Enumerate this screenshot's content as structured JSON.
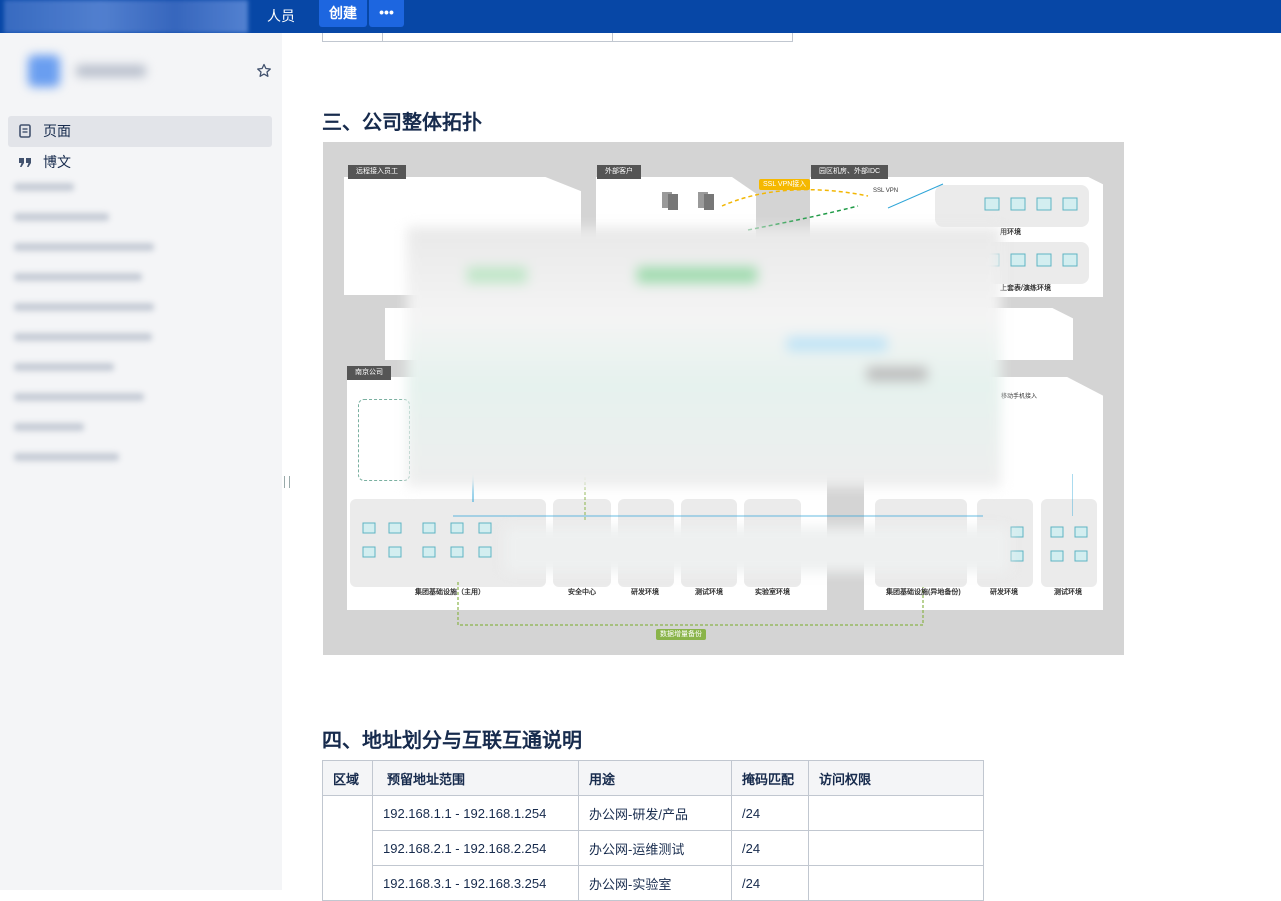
{
  "topbar": {
    "people": "人员",
    "create": "创建",
    "more": "•••"
  },
  "sidebar": {
    "items": [
      {
        "label": "页面"
      },
      {
        "label": "博文"
      }
    ]
  },
  "content": {
    "heading3": "三、公司整体拓扑",
    "heading4": "四、地址划分与互联互通说明",
    "diagram": {
      "remote_staff": "远程接入员工",
      "external_customers": "外部客户",
      "datacenter": "园区机房、外部IDC",
      "ssl_vpn_access": "SSL VPN接入",
      "ssl_vpn": "SSL VPN",
      "nanjing_office": "南京公司",
      "env_prod": "用环境",
      "env_staging": "上套表/演练环境",
      "mobile_access": "移动手机接入",
      "group_infra_main": "集团基础设施（主用）",
      "security_center": "安全中心",
      "rd_env": "研发环境",
      "test_env": "测试环境",
      "lab_env": "实验室环境",
      "group_infra_backup": "集团基础设施(异地备份)",
      "rd_env2": "研发环境",
      "test_env2": "测试环境",
      "data_backup": "数据增量备份"
    },
    "table": {
      "headers": [
        "区域",
        "预留地址范围",
        "用途",
        "掩码匹配",
        "访问权限"
      ],
      "rows": [
        [
          "",
          "192.168.1.1 - 192.168.1.254",
          "办公网-研发/产品",
          "/24",
          ""
        ],
        [
          "",
          "192.168.2.1 - 192.168.2.254",
          "办公网-运维测试",
          "/24",
          ""
        ],
        [
          "",
          "192.168.3.1 - 192.168.3.254",
          "办公网-实验室",
          "/24",
          ""
        ]
      ]
    }
  },
  "colors": {
    "topbar": "#0747a6",
    "accent": "#1d66e0",
    "sidebar": "#f4f5f7"
  }
}
